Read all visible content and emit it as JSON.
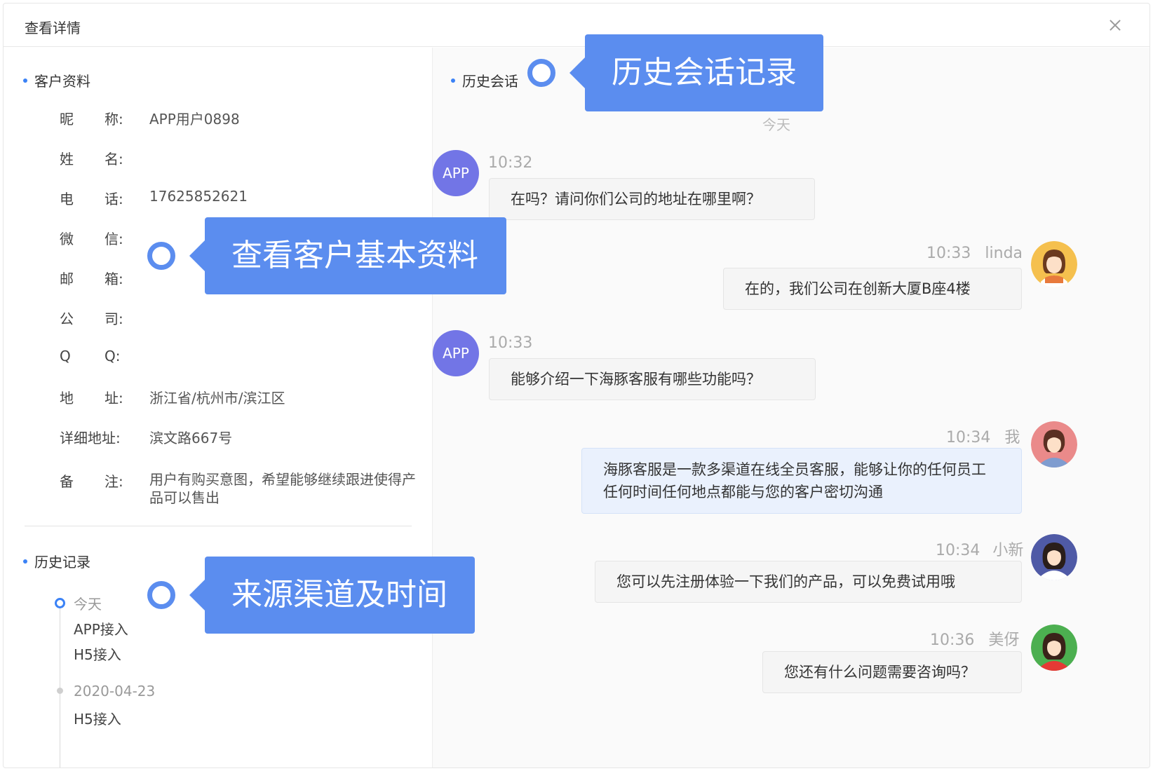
{
  "dialog": {
    "title": "查看详情"
  },
  "profile": {
    "section_title": "客户资料",
    "fields": [
      {
        "l1": "昵",
        "l2": "称:",
        "value": "APP用户0898"
      },
      {
        "l1": "姓",
        "l2": "名:",
        "value": ""
      },
      {
        "l1": "电",
        "l2": "话:",
        "value": "17625852621"
      },
      {
        "l1": "微",
        "l2": "信:",
        "value": ""
      },
      {
        "l1": "邮",
        "l2": "箱:",
        "value": ""
      },
      {
        "l1": "公",
        "l2": "司:",
        "value": ""
      },
      {
        "l1": "Q",
        "l2": "Q:",
        "value": ""
      },
      {
        "l1": "地",
        "l2": "址:",
        "value": "浙江省/杭州市/滨江区"
      },
      {
        "l1": "详细地址:",
        "l2": "",
        "value": "滨文路667号"
      }
    ],
    "remark": {
      "l1": "备",
      "l2": "注:",
      "value": "用户有购买意图，希望能够继续跟进使得产品可以售出"
    }
  },
  "history": {
    "section_title": "历史记录",
    "groups": [
      {
        "date": "今天",
        "items": [
          "APP接入",
          "H5接入"
        ]
      },
      {
        "date": "2020-04-23",
        "items": [
          "H5接入"
        ]
      }
    ]
  },
  "conversation": {
    "section_title": "历史会话",
    "day_separator": "今天",
    "messages": [
      {
        "side": "left",
        "avatar": "APP",
        "time": "10:32",
        "sender": "",
        "text": "在吗？请问你们公司的地址在哪里啊？"
      },
      {
        "side": "right",
        "avatar": "linda",
        "time": "10:33",
        "sender": "linda",
        "text": "在的，我们公司在创新大厦B座4楼"
      },
      {
        "side": "left",
        "avatar": "APP",
        "time": "10:33",
        "sender": "",
        "text": "能够介绍一下海豚客服有哪些功能吗？"
      },
      {
        "side": "right",
        "avatar": "me",
        "time": "10:34",
        "sender": "我",
        "text": "海豚客服是一款多渠道在线全员客服，能够让你的任何员工任何时间任何地点都能与您的客户密切沟通"
      },
      {
        "side": "right",
        "avatar": "xiaoxin",
        "time": "10:34",
        "sender": "小新",
        "text": "您可以先注册体验一下我们的产品，可以免费试用哦"
      },
      {
        "side": "right",
        "avatar": "meiya",
        "time": "10:36",
        "sender": "美伢",
        "text": "您还有什么问题需要咨询吗？"
      }
    ]
  },
  "callouts": {
    "history_chat": "历史会话记录",
    "profile": "查看客户基本资料",
    "source": "来源渠道及时间"
  },
  "colors": {
    "accent": "#3b82f6",
    "callout": "#5b8def",
    "app_avatar": "#7275e6"
  }
}
